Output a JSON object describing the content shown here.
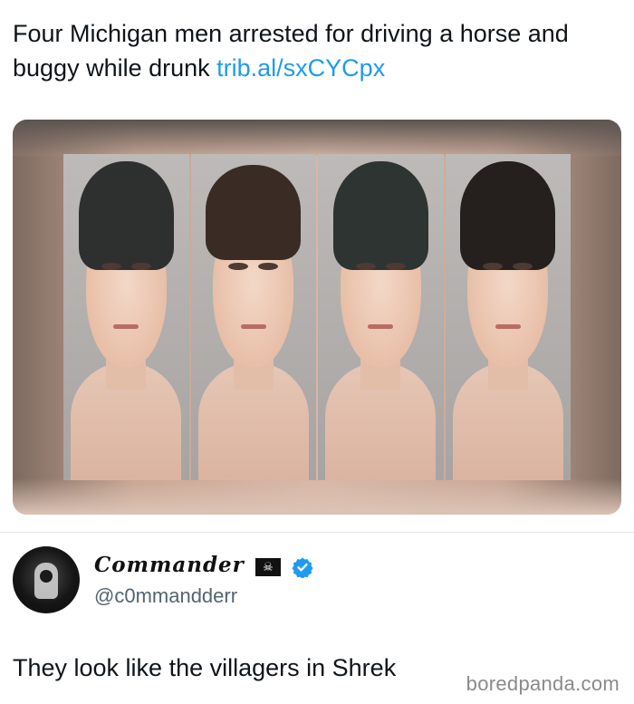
{
  "tweet": {
    "text": "Four Michigan men arrested for driving a horse and buggy while drunk",
    "link": "trib.al/sxCYCpx"
  },
  "media": {
    "icons": [
      "mugshot-photo",
      "mugshot-photo",
      "mugshot-photo",
      "mugshot-photo"
    ]
  },
  "reply": {
    "display_name": "Commander",
    "flag_icon": "pirate-flag-icon",
    "verified_icon": "verified-badge-icon",
    "handle": "@c0mmandderr",
    "text": "They look like the villagers in Shrek"
  },
  "watermark": "boredpanda.com",
  "colors": {
    "link": "#1d9bf0",
    "verified": "#1d9bf0",
    "handle": "#536471"
  }
}
